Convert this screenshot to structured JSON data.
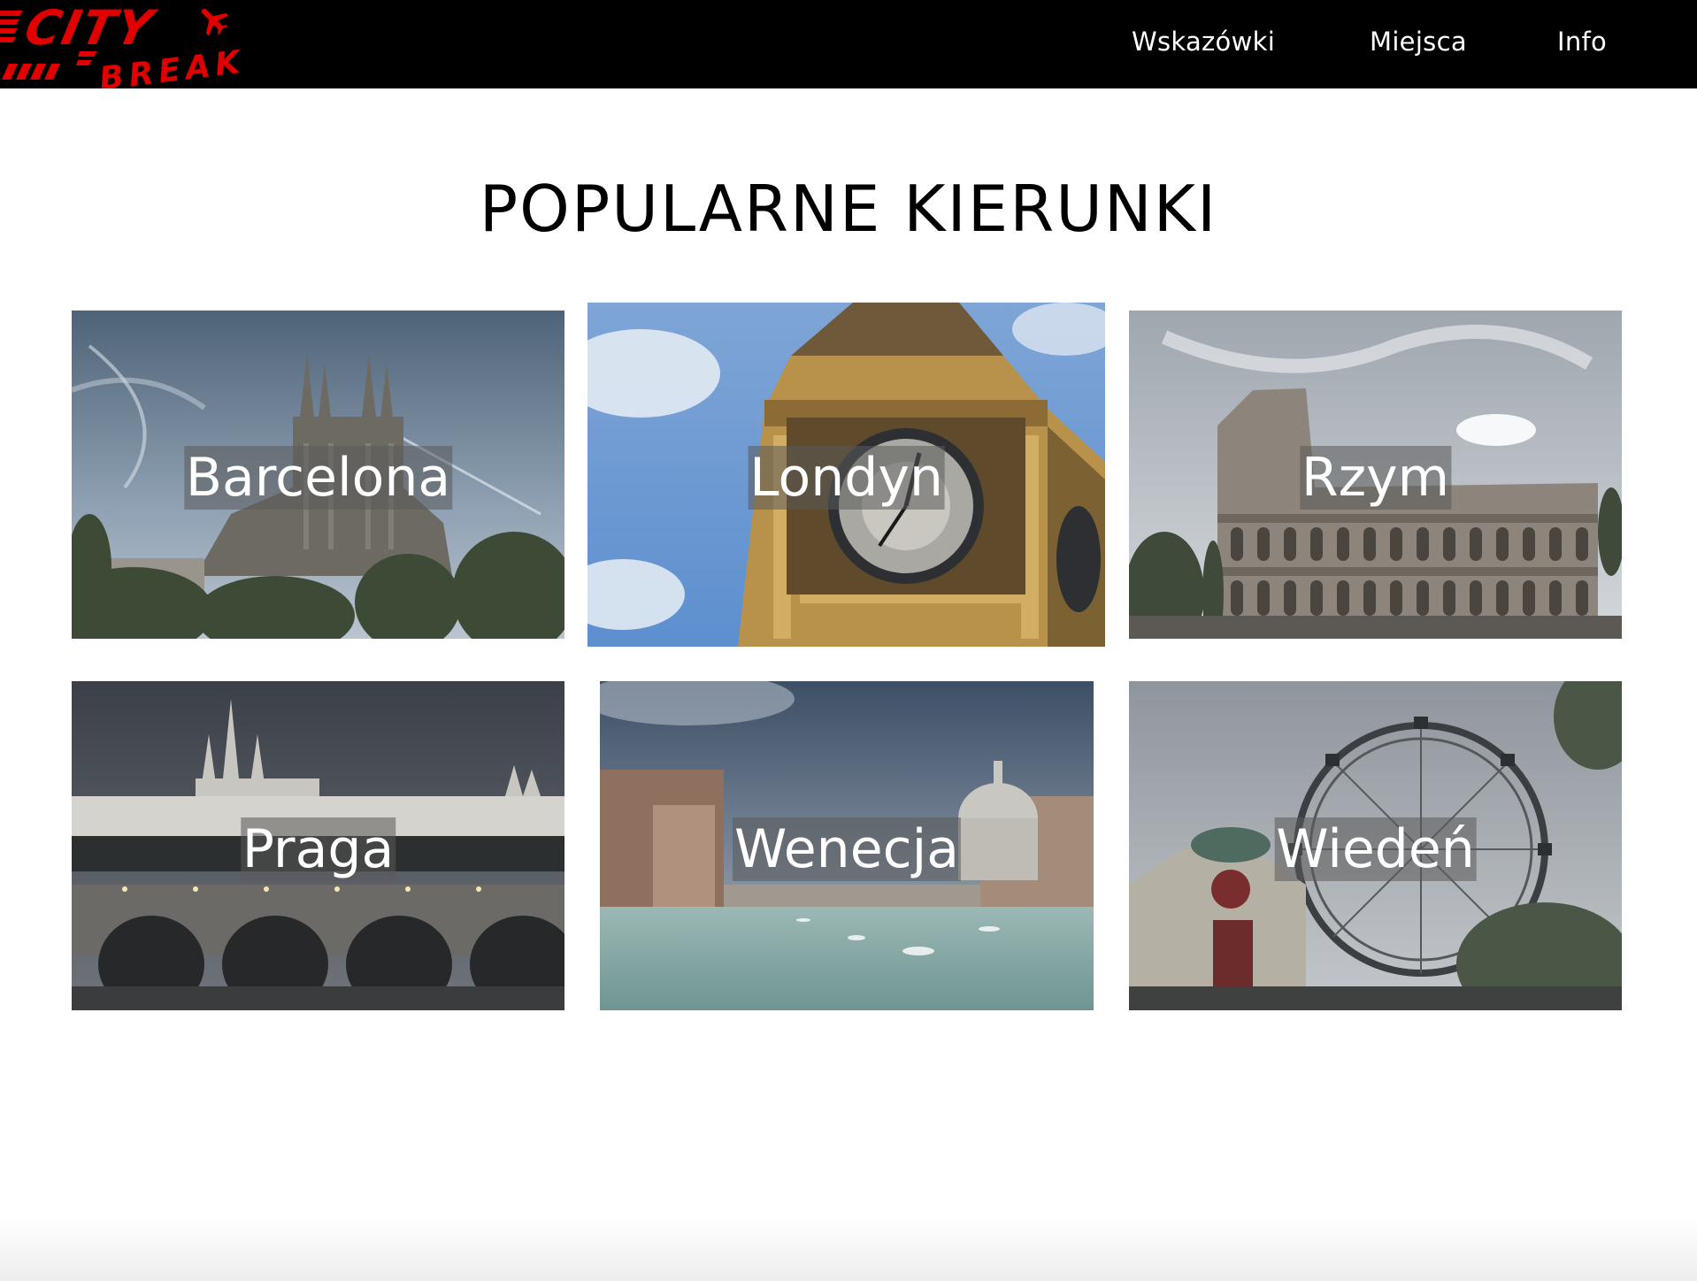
{
  "header": {
    "logo": {
      "line1": "CITY",
      "line2": "BREAK",
      "icon": "airplane-icon",
      "color": "#e10000"
    },
    "nav": [
      {
        "label": "Wskazówki"
      },
      {
        "label": "Miejsca"
      },
      {
        "label": "Info"
      }
    ]
  },
  "main": {
    "title": "POPULARNE KIERUNKI",
    "destinations": [
      {
        "name": "Barcelona",
        "image": "sagrada-familia"
      },
      {
        "name": "Londyn",
        "image": "big-ben"
      },
      {
        "name": "Rzym",
        "image": "colosseum"
      },
      {
        "name": "Praga",
        "image": "charles-bridge-prague-castle"
      },
      {
        "name": "Wenecja",
        "image": "grand-canal"
      },
      {
        "name": "Wiedeń",
        "image": "prater-ferris-wheel"
      }
    ]
  },
  "colors": {
    "header_bg": "#000000",
    "nav_text": "#ffffff",
    "label_overlay": "rgba(90,90,90,0.55)"
  }
}
